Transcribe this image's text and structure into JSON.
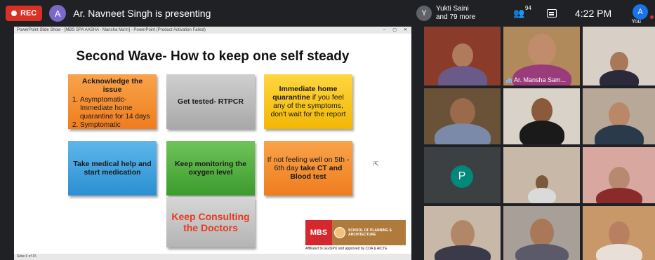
{
  "meeting": {
    "rec_label": "REC",
    "presenter_initial": "A",
    "presenting_text": "Ar. Navneet Singh is presenting",
    "viewer_initial": "Y",
    "viewer_name": "Yukti Saini",
    "viewer_more": "and 79 more",
    "people_count": "94",
    "time": "4:22 PM",
    "you_initial": "A",
    "you_label": "You"
  },
  "ppt": {
    "window_title": "PowerPoint Slide Show - [MBS SPA AASHA - Mansha Ma'm] - PowerPoint (Product Activation Failed)",
    "controls": [
      "–",
      "▢",
      "✕"
    ],
    "status_text": "Slide 6 of 15"
  },
  "slide": {
    "title": "Second Wave- How to keep one self steady",
    "box1_header": "Acknowledge the issue",
    "box1_items": [
      "Asymptomatic- Immediate home quarantine for 14 days",
      "Symptomatic"
    ],
    "box2": "Get tested- RTPCR",
    "box3_bold": "Immediate home quarantine",
    "box3_rest": "if you feel any of the symptoms, don't wait for the report",
    "box4": "Take medical help and start medication",
    "box5": "Keep monitoring the oxygen level",
    "box6_plain": "If not feeling well on 5th - 6th day",
    "box6_bold": "take CT and Blood test",
    "box7": "Keep Consulting the Doctors",
    "logo_mbs": "MBS",
    "logo_spa": "SCHOOL OF PLANNING & ARCHITECTURE",
    "affiliation": "Affiliated to GGSIPU and approved by COA & AICTE"
  },
  "participants": {
    "highlight_name": "Ar. Mansha Sam...",
    "p_initial": "P"
  }
}
